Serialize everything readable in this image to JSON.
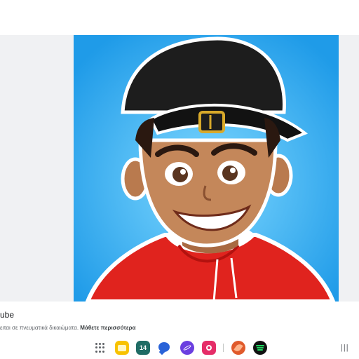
{
  "caption": {
    "title": "ube",
    "notice_text": "ειται σε πνευματικά δικαιώματα.",
    "notice_link": "Μάθετε περισσότερα"
  },
  "image": {
    "subject": "cartoon avatar of a smiling boy in black cap and red hoodie",
    "background_color": "#29a8f0",
    "hoodie_color": "#e0231e",
    "cap_color": "#1d1d1d"
  },
  "taskbar": {
    "calendar_date": "14",
    "recents_glyph": "|||"
  },
  "icons": [
    "apps-grid-icon",
    "files-icon",
    "calendar-icon",
    "messages-icon",
    "internet-icon",
    "camera-icon",
    "notes-icon",
    "spotify-icon",
    "recents-button"
  ]
}
